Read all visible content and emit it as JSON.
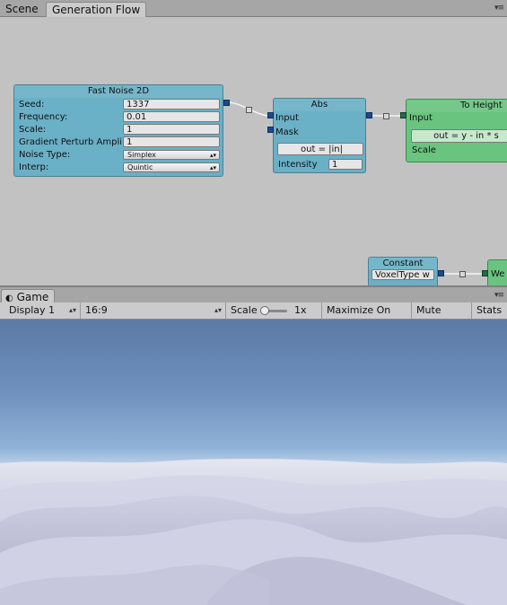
{
  "top_tabs": [
    {
      "label": "Scene"
    },
    {
      "label": "Generation Flow"
    }
  ],
  "menu_glyph": "▾≡",
  "nodes": {
    "fast_noise": {
      "title": "Fast Noise 2D",
      "rows": [
        {
          "label": "Seed:",
          "value": "1337"
        },
        {
          "label": "Frequency:",
          "value": "0.01"
        },
        {
          "label": "Scale:",
          "value": "1"
        },
        {
          "label": "Gradient Perturb Ampli",
          "value": "1"
        }
      ],
      "noise_type_label": "Noise Type:",
      "noise_type_value": "Simplex",
      "interp_label": "Interp:",
      "interp_value": "Quintic"
    },
    "abs": {
      "title": "Abs",
      "input_label": "Input",
      "mask_label": "Mask",
      "formula": "out = |in|",
      "intensity_label": "Intensity",
      "intensity_value": "1"
    },
    "to_height": {
      "title": "To Height",
      "input_label": "Input",
      "formula": "out = y - in * s",
      "scale_label": "Scale"
    },
    "constant": {
      "title": "Constant",
      "value": "VoxelType w"
    },
    "weight": {
      "title": "We"
    }
  },
  "game": {
    "tab_label": "Game",
    "display": "Display 1",
    "aspect": "16:9",
    "scale_label": "Scale",
    "scale_value": "1x",
    "maximize": "Maximize On Play",
    "mute": "Mute Audio",
    "stats": "Stats"
  },
  "colors": {
    "node_blue": "#6ab0c6",
    "node_green": "#69c47f",
    "port_blue": "#1c4a8c"
  }
}
